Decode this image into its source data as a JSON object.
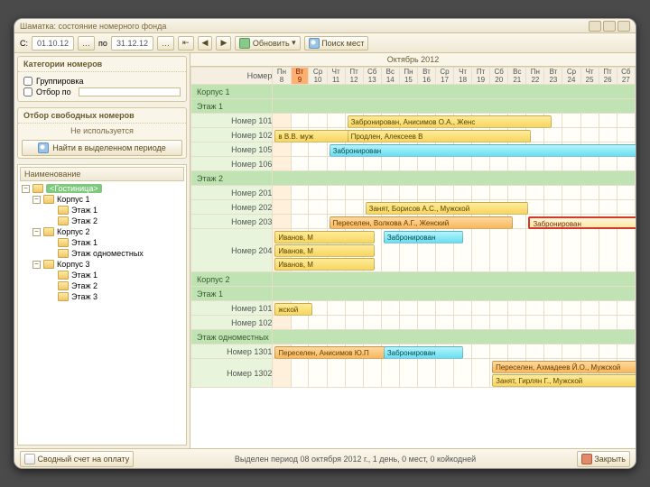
{
  "window": {
    "title": "Шаматка: состояние номерного фонда"
  },
  "toolbar": {
    "date_from_prefix": "С:",
    "date_from": "01.10.12",
    "date_to_prefix": "по",
    "date_to": "31.12.12",
    "refresh": "Обновить",
    "find_places": "Поиск мест"
  },
  "panel_categories": {
    "title": "Категории номеров",
    "checkbox_group": "Группировка",
    "checkbox_filter": "Отбор по"
  },
  "panel_filter": {
    "title": "Отбор свободных номеров",
    "not_used": "Не используется",
    "find_period_btn": "Найти в выделенном периоде"
  },
  "tree": {
    "header": "Наименование",
    "root": "<Гостиница>",
    "nodes": [
      {
        "label": "Корпус 1",
        "indent": 1,
        "expandable": "−"
      },
      {
        "label": "Этаж 1",
        "indent": 2,
        "expandable": ""
      },
      {
        "label": "Этаж 2",
        "indent": 2,
        "expandable": ""
      },
      {
        "label": "Корпус 2",
        "indent": 1,
        "expandable": "−"
      },
      {
        "label": "Этаж 1",
        "indent": 2,
        "expandable": ""
      },
      {
        "label": "Этаж одноместных",
        "indent": 2,
        "expandable": ""
      },
      {
        "label": "Корпус 3",
        "indent": 1,
        "expandable": "−"
      },
      {
        "label": "Этаж 1",
        "indent": 2,
        "expandable": ""
      },
      {
        "label": "Этаж 2",
        "indent": 2,
        "expandable": ""
      },
      {
        "label": "Этаж 3",
        "indent": 2,
        "expandable": ""
      }
    ]
  },
  "calendar": {
    "month_title": "Октябрь 2012",
    "room_header": "Номер",
    "days": [
      {
        "dow": "Пн",
        "d": "8"
      },
      {
        "dow": "Вт",
        "d": "9",
        "today": true
      },
      {
        "dow": "Ср",
        "d": "10"
      },
      {
        "dow": "Чт",
        "d": "11"
      },
      {
        "dow": "Пт",
        "d": "12"
      },
      {
        "dow": "Сб",
        "d": "13"
      },
      {
        "dow": "Вс",
        "d": "14"
      },
      {
        "dow": "Пн",
        "d": "15"
      },
      {
        "dow": "Вт",
        "d": "16"
      },
      {
        "dow": "Ср",
        "d": "17"
      },
      {
        "dow": "Чт",
        "d": "18"
      },
      {
        "dow": "Пт",
        "d": "19"
      },
      {
        "dow": "Сб",
        "d": "20"
      },
      {
        "dow": "Вс",
        "d": "21"
      },
      {
        "dow": "Пн",
        "d": "22"
      },
      {
        "dow": "Вт",
        "d": "23"
      },
      {
        "dow": "Ср",
        "d": "24"
      },
      {
        "dow": "Чт",
        "d": "25"
      },
      {
        "dow": "Пт",
        "d": "26"
      },
      {
        "dow": "Сб",
        "d": "27"
      }
    ],
    "sections": [
      {
        "label": "Корпус 1",
        "rows": []
      },
      {
        "label": "Этаж 1",
        "rows": [
          {
            "room": "Номер 101",
            "bars": [
              {
                "from": 4,
                "span": 10,
                "cls": "yellow",
                "text": "Забронирован, Анисимов О.А., Женс"
              }
            ]
          },
          {
            "room": "Номер 102",
            "bars": [
              {
                "from": 0,
                "span": 4,
                "cls": "yellow",
                "text": "в В.В. муж"
              },
              {
                "from": 4,
                "span": 9,
                "cls": "yellow",
                "text": "Продлен, Алексеев В"
              }
            ]
          },
          {
            "room": "Номер 105",
            "bars": [
              {
                "from": 3,
                "span": 17,
                "cls": "cyan",
                "text": "Забронирован"
              }
            ]
          },
          {
            "room": "Номер 106",
            "bars": []
          }
        ]
      },
      {
        "label": "Этаж 2",
        "rows": [
          {
            "room": "Номер 201",
            "bars": []
          },
          {
            "room": "Номер 202",
            "bars": [
              {
                "from": 5,
                "span": 8,
                "cls": "yellow",
                "text": "Занят, Борисов А.С., Мужской"
              }
            ]
          },
          {
            "room": "Номер 203",
            "bars": [
              {
                "from": 3,
                "span": 9,
                "cls": "orange",
                "text": "Переселен, Волкова А.Г., Женский"
              },
              {
                "from": 14,
                "span": 6,
                "cls": "red-outline",
                "text": "Забронирован"
              }
            ]
          },
          {
            "room": "Номер 204",
            "bars": [
              {
                "from": 0,
                "span": 5,
                "cls": "yellow",
                "text": "Иванов, М"
              },
              {
                "from": 0,
                "span": 5,
                "cls": "yellow",
                "text": "Иванов, М",
                "stack": 1
              },
              {
                "from": 0,
                "span": 5,
                "cls": "yellow",
                "text": "Иванов, М",
                "stack": 2
              },
              {
                "from": 6,
                "span": 4,
                "cls": "cyan",
                "text": "Забронирован"
              }
            ]
          }
        ]
      },
      {
        "label": "Корпус 2",
        "rows": []
      },
      {
        "label": "Этаж 1",
        "rows": [
          {
            "room": "Номер 101",
            "bars": [
              {
                "from": 0,
                "span": 2,
                "cls": "yellow",
                "text": "жской"
              }
            ]
          },
          {
            "room": "Номер 102",
            "bars": []
          }
        ]
      },
      {
        "label": "Этаж одноместных",
        "rows": [
          {
            "room": "Номер 1301",
            "bars": [
              {
                "from": 0,
                "span": 6,
                "cls": "orange",
                "text": "Переселен, Анисимов Ю.П"
              },
              {
                "from": 6,
                "span": 4,
                "cls": "cyan",
                "text": "Забронирован"
              }
            ]
          },
          {
            "room": "Номер 1302",
            "bars": [
              {
                "from": 12,
                "span": 8,
                "cls": "orange",
                "text": "Переселен, Ахмадеев Й.О., Мужской"
              },
              {
                "from": 12,
                "span": 8,
                "cls": "yellow",
                "text": "Занят, Гирлян Г., Мужской",
                "stack": 1
              }
            ]
          }
        ]
      }
    ]
  },
  "statusbar": {
    "left_btn": "Сводный счет на оплату",
    "middle": "Выделен период 08 октября 2012 г., 1 день, 0 мест, 0 койкодней",
    "close_btn": "Закрыть"
  }
}
